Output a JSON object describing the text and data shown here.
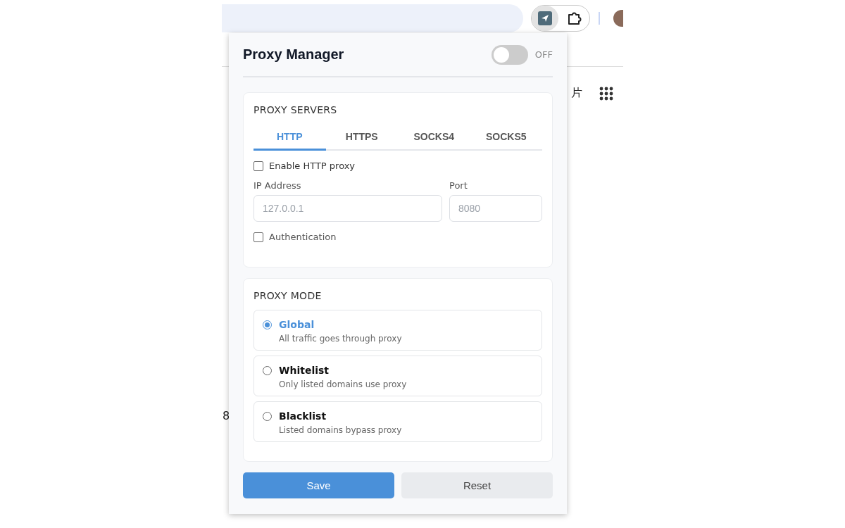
{
  "browser": {
    "background_texts": [
      "片",
      "8"
    ]
  },
  "popup": {
    "title": "Proxy Manager",
    "toggle": {
      "on": false,
      "label": "OFF"
    },
    "servers": {
      "heading": "PROXY SERVERS",
      "tabs": [
        {
          "label": "HTTP",
          "selected": true
        },
        {
          "label": "HTTPS",
          "selected": false
        },
        {
          "label": "SOCKS4",
          "selected": false
        },
        {
          "label": "SOCKS5",
          "selected": false
        }
      ],
      "enable": {
        "label": "Enable HTTP proxy",
        "checked": false
      },
      "ip": {
        "label": "IP Address",
        "placeholder": "127.0.0.1"
      },
      "port": {
        "label": "Port",
        "placeholder": "8080"
      },
      "auth": {
        "label": "Authentication",
        "checked": false
      }
    },
    "mode": {
      "heading": "PROXY MODE",
      "options": [
        {
          "title": "Global",
          "description": "All traffic goes through proxy",
          "selected": true
        },
        {
          "title": "Whitelist",
          "description": "Only listed domains use proxy",
          "selected": false
        },
        {
          "title": "Blacklist",
          "description": "Listed domains bypass proxy",
          "selected": false
        }
      ]
    },
    "buttons": {
      "save": "Save",
      "reset": "Reset"
    }
  }
}
